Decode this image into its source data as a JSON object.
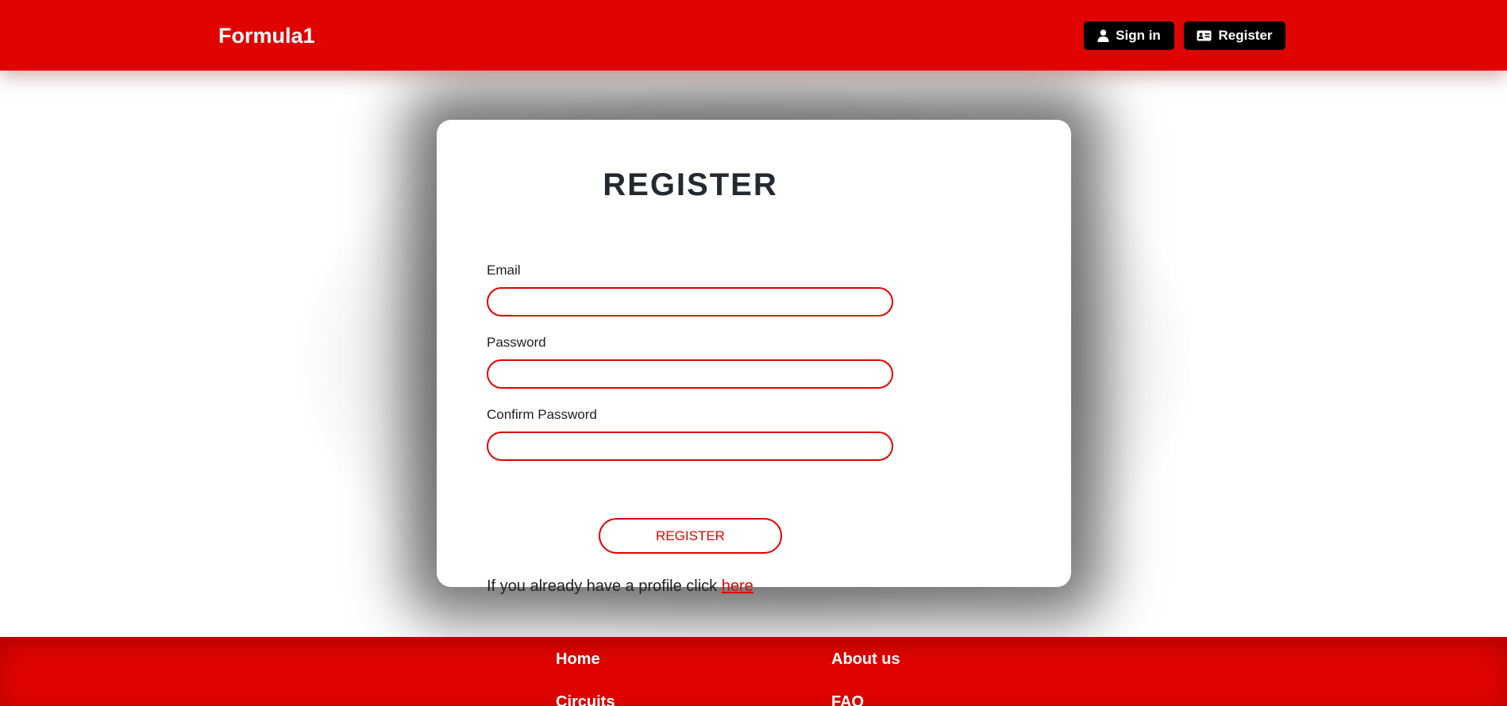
{
  "header": {
    "brand": "Formula1",
    "signin_label": "Sign in",
    "register_label": "Register"
  },
  "form": {
    "title": "REGISTER",
    "email_label": "Email",
    "email_value": "",
    "password_label": "Password",
    "password_value": "",
    "confirm_label": "Confirm Password",
    "confirm_value": "",
    "submit_label": "REGISTER",
    "login_prompt": "If you already have a profile click",
    "login_link": "here"
  },
  "footer": {
    "links": [
      "Home",
      "About us",
      "Circuits",
      "FAQ"
    ]
  },
  "colors": {
    "brand_red": "#e00400",
    "black": "#000000",
    "white": "#ffffff"
  },
  "icons": {
    "signin": "user-icon",
    "register": "id-card-icon"
  }
}
